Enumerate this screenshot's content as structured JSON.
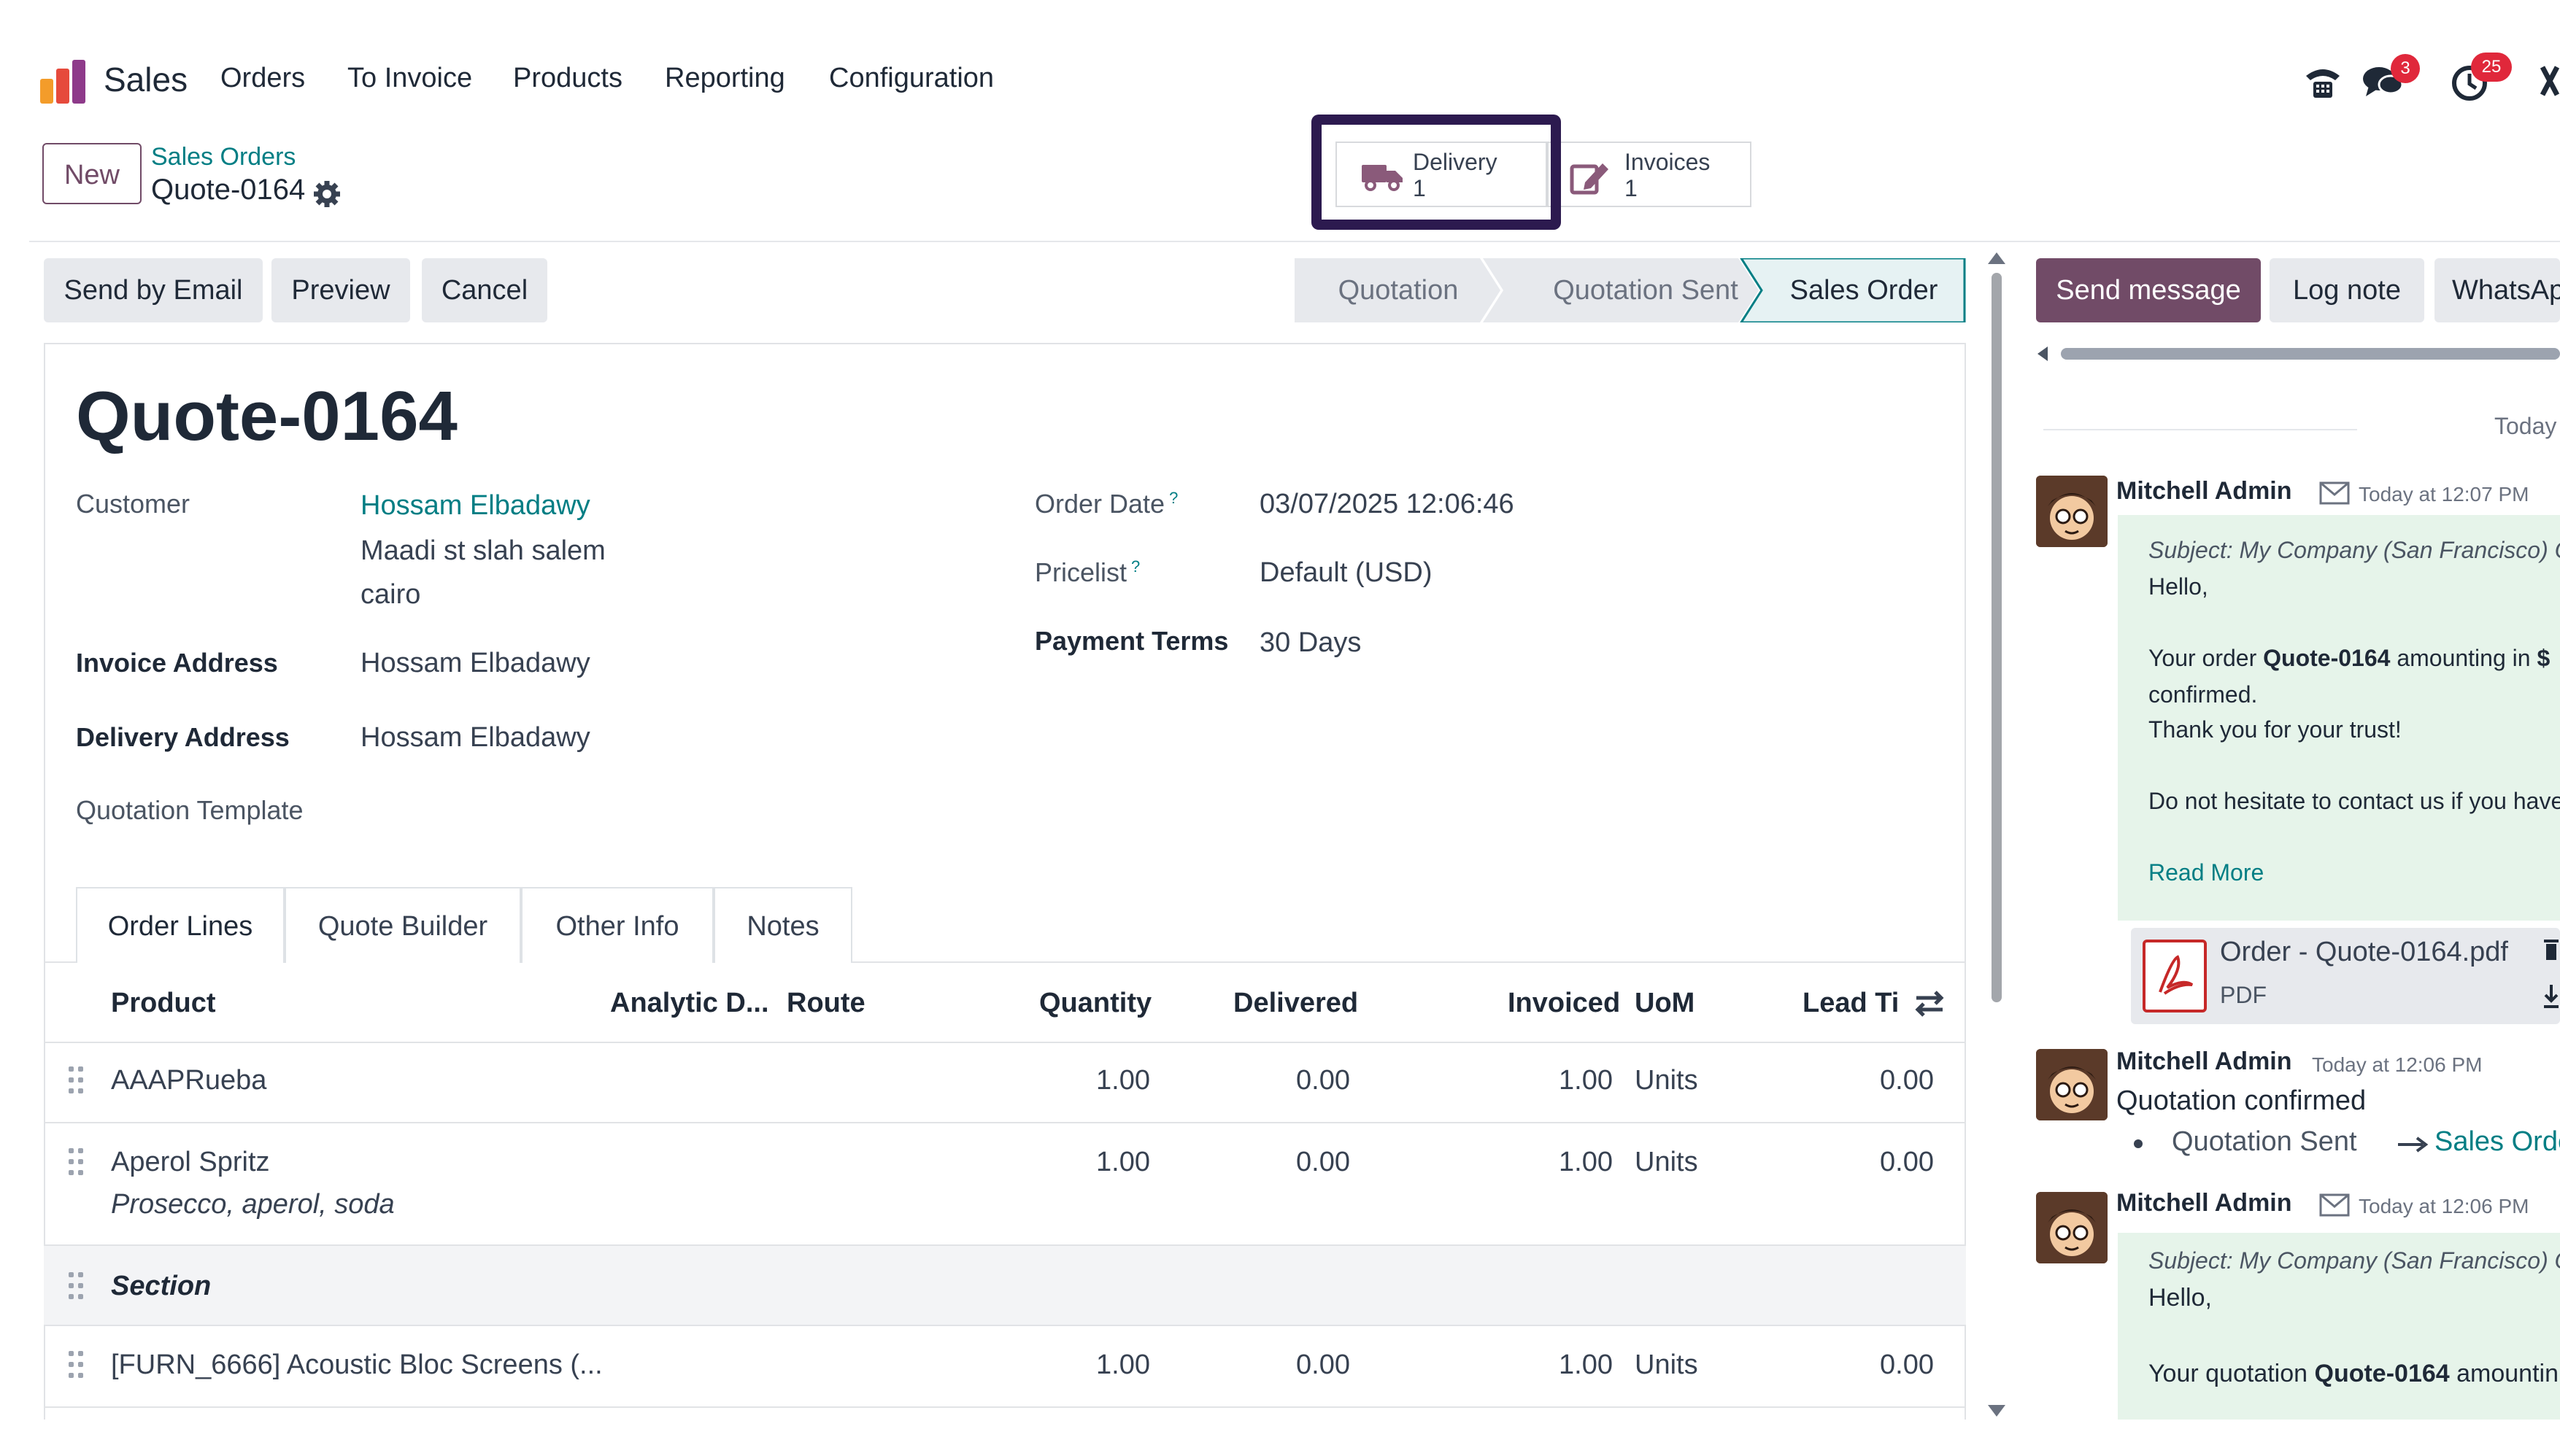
{
  "nav": {
    "app_name": "Sales",
    "menu": [
      "Orders",
      "To Invoice",
      "Products",
      "Reporting",
      "Configuration"
    ],
    "messages_badge": "3",
    "activities_badge": "25"
  },
  "control": {
    "new_label": "New",
    "breadcrumb_parent": "Sales Orders",
    "breadcrumb_current": "Quote-0164"
  },
  "smart_buttons": {
    "delivery_label": "Delivery",
    "delivery_count": "1",
    "invoices_label": "Invoices",
    "invoices_count": "1"
  },
  "actions": [
    "Send by Email",
    "Preview",
    "Cancel"
  ],
  "statusbar": [
    "Quotation",
    "Quotation Sent",
    "Sales Order"
  ],
  "form": {
    "title": "Quote-0164",
    "customer_label": "Customer",
    "customer_name": "Hossam Elbadawy",
    "customer_street": "Maadi st slah salem",
    "customer_city": "cairo",
    "invoice_address_label": "Invoice Address",
    "invoice_address": "Hossam Elbadawy",
    "delivery_address_label": "Delivery Address",
    "delivery_address": "Hossam Elbadawy",
    "template_label": "Quotation Template",
    "order_date_label": "Order Date",
    "order_date": "03/07/2025 12:06:46",
    "pricelist_label": "Pricelist",
    "pricelist": "Default (USD)",
    "payment_terms_label": "Payment Terms",
    "payment_terms": "30 Days",
    "help_mark": "?"
  },
  "tabs": [
    "Order Lines",
    "Quote Builder",
    "Other Info",
    "Notes"
  ],
  "table": {
    "headers": [
      "Product",
      "Analytic D...",
      "Route",
      "Quantity",
      "Delivered",
      "Invoiced",
      "UoM",
      "Lead Tir"
    ],
    "rows": [
      {
        "product": "AAAPRueba",
        "qty": "1.00",
        "delivered": "0.00",
        "invoiced": "1.00",
        "uom": "Units",
        "lead": "0.00"
      },
      {
        "product": "Aperol Spritz",
        "desc": "Prosecco, aperol, soda",
        "qty": "1.00",
        "delivered": "0.00",
        "invoiced": "1.00",
        "uom": "Units",
        "lead": "0.00"
      },
      {
        "section": "Section"
      },
      {
        "product": "[FURN_6666] Acoustic Bloc Screens (...",
        "qty": "1.00",
        "delivered": "0.00",
        "invoiced": "1.00",
        "uom": "Units",
        "lead": "0.00"
      }
    ]
  },
  "chatter": {
    "send_message": "Send message",
    "log_note": "Log note",
    "whatsapp": "WhatsApp",
    "today": "Today",
    "messages": [
      {
        "author": "Mitchell Admin",
        "time": "Today at 12:07 PM",
        "subject": "Subject: My Company (San Francisco) Ord",
        "hello": "Hello,",
        "body_pre": "Your order ",
        "body_bold": "Quote-0164",
        "body_post": " amounting in ",
        "body_amount": "$",
        "confirmed": "confirmed.",
        "thanks": "Thank you for your trust!",
        "contact": "Do not hesitate to contact us if you have",
        "read_more": "Read More"
      },
      {
        "author": "Mitchell Admin",
        "time": "Today at 12:06 PM",
        "text": "Quotation confirmed",
        "change_from": "Quotation Sent",
        "change_to": "Sales Order"
      },
      {
        "author": "Mitchell Admin",
        "time": "Today at 12:06 PM",
        "subject": "Subject: My Company (San Francisco) Quo",
        "hello": "Hello,",
        "body_pre": "Your quotation ",
        "body_bold": "Quote-0164",
        "body_post": " amountin"
      }
    ],
    "attachment_name": "Order - Quote-0164.pdf",
    "attachment_type": "PDF"
  },
  "colors": {
    "brand": "#714b67",
    "link": "#017e84",
    "highlight": "#2c1a4f",
    "badge": "#e0283b"
  }
}
